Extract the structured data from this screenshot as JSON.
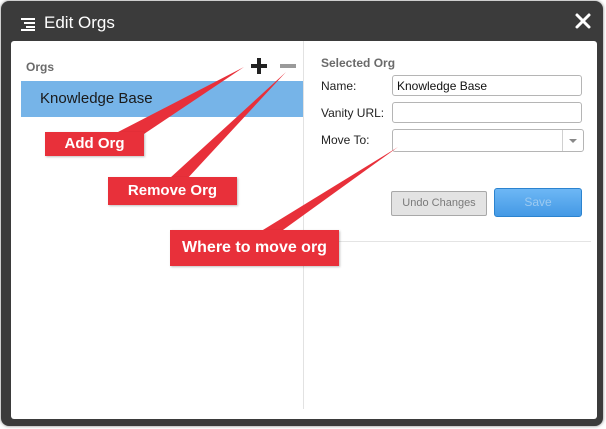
{
  "window": {
    "title": "Edit Orgs"
  },
  "orgs": {
    "label": "Orgs",
    "items": [
      {
        "label": "Knowledge Base",
        "selected": true
      }
    ]
  },
  "selected_org": {
    "heading": "Selected Org",
    "name_label": "Name:",
    "name_value": "Knowledge Base",
    "vanity_label": "Vanity URL:",
    "vanity_value": "",
    "move_label": "Move To:",
    "move_value": ""
  },
  "buttons": {
    "undo": "Undo Changes",
    "save": "Save"
  },
  "callouts": {
    "add": "Add Org",
    "remove": "Remove Org",
    "move": "Where to move org"
  },
  "colors": {
    "titlebar": "#3b3b3b",
    "selected_item": "#76b4e8",
    "callout": "#e8303a",
    "save_button": "#4499e5"
  },
  "icons": [
    "menu-icon",
    "close-icon",
    "plus-icon",
    "minus-icon",
    "chevron-down-icon"
  ]
}
